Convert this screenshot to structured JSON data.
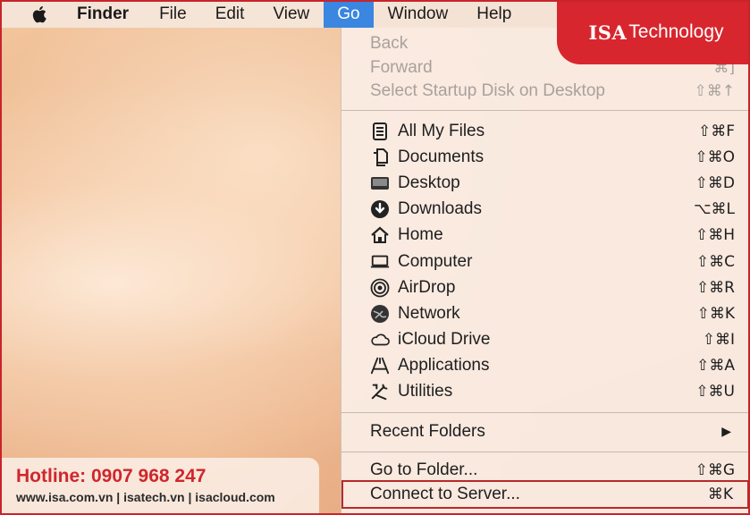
{
  "menubar": {
    "apple_icon": "apple-logo-icon",
    "app_name": "Finder",
    "items": [
      "File",
      "Edit",
      "View",
      "Go",
      "Window",
      "Help"
    ],
    "active": "Go"
  },
  "brand": {
    "part1": "ISA",
    "part2": "Technology",
    "color": "#d8262e"
  },
  "go_menu": {
    "top": [
      {
        "label": "Back",
        "shortcut": "",
        "disabled": true
      },
      {
        "label": "Forward",
        "shortcut": "⌘]",
        "disabled": true
      },
      {
        "label": "Select Startup Disk on Desktop",
        "shortcut": "⇧⌘↑",
        "disabled": true
      }
    ],
    "places": [
      {
        "label": "All My Files",
        "shortcut": "⇧⌘F",
        "icon": "all-my-files-icon"
      },
      {
        "label": "Documents",
        "shortcut": "⇧⌘O",
        "icon": "documents-icon"
      },
      {
        "label": "Desktop",
        "shortcut": "⇧⌘D",
        "icon": "desktop-icon"
      },
      {
        "label": "Downloads",
        "shortcut": "⌥⌘L",
        "icon": "downloads-icon"
      },
      {
        "label": "Home",
        "shortcut": "⇧⌘H",
        "icon": "home-icon"
      },
      {
        "label": "Computer",
        "shortcut": "⇧⌘C",
        "icon": "computer-icon"
      },
      {
        "label": "AirDrop",
        "shortcut": "⇧⌘R",
        "icon": "airdrop-icon"
      },
      {
        "label": "Network",
        "shortcut": "⇧⌘K",
        "icon": "network-icon"
      },
      {
        "label": "iCloud Drive",
        "shortcut": "⇧⌘I",
        "icon": "icloud-icon"
      },
      {
        "label": "Applications",
        "shortcut": "⇧⌘A",
        "icon": "applications-icon"
      },
      {
        "label": "Utilities",
        "shortcut": "⇧⌘U",
        "icon": "utilities-icon"
      }
    ],
    "recent": {
      "label": "Recent Folders",
      "submenu": "▶"
    },
    "bottom": [
      {
        "label": "Go to Folder...",
        "shortcut": "⇧⌘G"
      },
      {
        "label": "Connect to Server...",
        "shortcut": "⌘K"
      }
    ],
    "highlight_color": "#b52a2a"
  },
  "hotline": {
    "title": "Hotline: 0907 968 247",
    "sites": "www.isa.com.vn | isatech.vn | isacloud.com"
  }
}
